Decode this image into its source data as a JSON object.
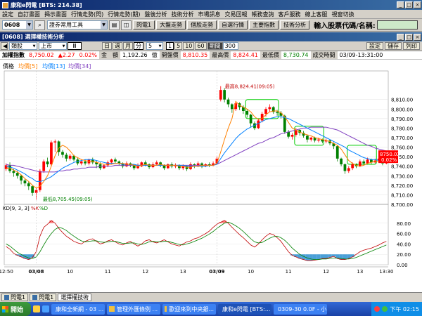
{
  "window": {
    "title": "康和e閃電 [BTS: 214.38]",
    "buttons": [
      "_",
      "□",
      "×"
    ]
  },
  "menu": [
    "設定",
    "自訂畫面",
    "揭示畫面",
    "行情走勢(閃)",
    "行情走勢(期)",
    "盤後分析",
    "技術分析",
    "市場訊息",
    "交易回報",
    "帳務查詢",
    "客戶服務",
    "線上客服",
    "視窗切換"
  ],
  "toolbar": {
    "stock_code": "0608",
    "tool_dropdown": "證券常用工具",
    "buttons": [
      "閃電1",
      "大盤走勢",
      "個股走勢",
      "自選行情",
      "主要指數",
      "技術分析"
    ],
    "prompt_label": "輸入股票代碼/名稱:",
    "prompt_value": ""
  },
  "chart_window": {
    "title": "[0608] 選擇權技術分析",
    "buttons": [
      "_",
      "□",
      "×"
    ],
    "controls": {
      "category": "類股",
      "market": "上市",
      "period_units": [
        "日",
        "週",
        "月",
        "分"
      ],
      "active_period_unit": "分",
      "interval_value": "5",
      "interval_options": [
        "1",
        "5",
        "10",
        "60"
      ],
      "active_interval": "1",
      "volume_label": "期間",
      "volume_value": "300",
      "right_buttons": [
        "設定",
        "儲存",
        "列印"
      ]
    },
    "quote": {
      "name_label": "加權指數",
      "price": "8,750.02",
      "change": "▲2.27",
      "change_pct": "0.02%",
      "amount_label": "金　額",
      "amount": "1,192.26",
      "amount_unit": "億",
      "open_label": "開盤價",
      "open": "8,810.35",
      "high_label": "最高價",
      "high": "8,824.41",
      "low_label": "最低價",
      "low": "8,730.74",
      "time_label": "成交時間",
      "time": "03/09-13:31:00"
    }
  },
  "chart_data": {
    "type": "candlestick",
    "price_panel": {
      "legend_title": "價格",
      "legend_items": [
        {
          "label": "均價[5]",
          "color": "#ff8000"
        },
        {
          "label": "均價[13]",
          "color": "#0080ff"
        },
        {
          "label": "均價[34]",
          "color": "#8040c0"
        }
      ],
      "ylim": [
        8700,
        8840
      ],
      "yticks": [
        "8,810.00",
        "8,800.00",
        "8,790.00",
        "8,780.00",
        "8,770.00",
        "8,760.00",
        "8,750.00",
        "8,740.00",
        "8,730.00",
        "8,720.00",
        "8,710.00",
        "8,700.00"
      ],
      "ytick_values": [
        8810,
        8800,
        8790,
        8780,
        8770,
        8760,
        8750,
        8740,
        8730,
        8720,
        8710,
        8700
      ],
      "annotations": [
        {
          "text": "最高8,824.41(09:05)"
        },
        {
          "text": "最低8,705.45(09:05)"
        }
      ],
      "last_price_box": {
        "value": "8750.02",
        "pct": "0.02%"
      },
      "highlight_boxes": 3
    },
    "kd_panel": {
      "legend": "KD[9, 3, 3]",
      "k_label": "%K",
      "d_label": "%D",
      "ylim": [
        0,
        100
      ],
      "yticks": [
        "80.00",
        "60.00",
        "40.00",
        "20.00",
        "0.00"
      ],
      "ytick_values": [
        80,
        60,
        40,
        20,
        0
      ]
    },
    "x_labels": [
      "12:50",
      "03/08",
      "10",
      "11",
      "12",
      "13",
      "03/09",
      "10",
      "11",
      "12",
      "13",
      "13:30"
    ],
    "x_label_positions": [
      0,
      8,
      17,
      27,
      37,
      47,
      56,
      65,
      75,
      85,
      94,
      101
    ],
    "candles": [
      [
        8737,
        8741,
        8743,
        8735
      ],
      [
        8741,
        8735,
        8744,
        8733
      ],
      [
        8735,
        8733,
        8737,
        8729
      ],
      [
        8733,
        8730,
        8735,
        8727
      ],
      [
        8730,
        8725,
        8731,
        8721
      ],
      [
        8725,
        8722,
        8727,
        8719
      ],
      [
        8722,
        8719,
        8724,
        8715
      ],
      [
        8719,
        8712,
        8720,
        8709
      ],
      [
        8712,
        8715,
        8717,
        8705
      ],
      [
        8715,
        8735,
        8737,
        8713
      ],
      [
        8735,
        8745,
        8747,
        8733
      ],
      [
        8745,
        8742,
        8749,
        8739
      ],
      [
        8742,
        8765,
        8767,
        8740
      ],
      [
        8765,
        8766,
        8768,
        8755
      ],
      [
        8766,
        8755,
        8767,
        8751
      ],
      [
        8755,
        8752,
        8757,
        8749
      ],
      [
        8752,
        8748,
        8754,
        8745
      ],
      [
        8748,
        8751,
        8753,
        8746
      ],
      [
        8751,
        8747,
        8752,
        8745
      ],
      [
        8747,
        8743,
        8749,
        8741
      ],
      [
        8743,
        8745,
        8747,
        8741
      ],
      [
        8745,
        8743,
        8747,
        8741
      ],
      [
        8743,
        8747,
        8748,
        8741
      ],
      [
        8747,
        8744,
        8749,
        8742
      ],
      [
        8744,
        8742,
        8746,
        8738
      ],
      [
        8742,
        8738,
        8744,
        8736
      ],
      [
        8738,
        8741,
        8742,
        8737
      ],
      [
        8741,
        8744,
        8746,
        8739
      ],
      [
        8744,
        8747,
        8748,
        8742
      ],
      [
        8747,
        8745,
        8749,
        8743
      ],
      [
        8745,
        8743,
        8746,
        8741
      ],
      [
        8743,
        8740,
        8744,
        8738
      ],
      [
        8740,
        8743,
        8745,
        8739
      ],
      [
        8743,
        8741,
        8744,
        8739
      ],
      [
        8741,
        8738,
        8742,
        8736
      ],
      [
        8738,
        8740,
        8743,
        8737
      ],
      [
        8740,
        8744,
        8745,
        8739
      ],
      [
        8744,
        8742,
        8746,
        8740
      ],
      [
        8742,
        8739,
        8743,
        8737
      ],
      [
        8739,
        8742,
        8744,
        8738
      ],
      [
        8742,
        8744,
        8746,
        8741
      ],
      [
        8744,
        8741,
        8745,
        8739
      ],
      [
        8741,
        8738,
        8742,
        8736
      ],
      [
        8738,
        8742,
        8743,
        8737
      ],
      [
        8742,
        8740,
        8744,
        8738
      ],
      [
        8740,
        8741,
        8743,
        8738
      ],
      [
        8741,
        8738,
        8742,
        8736
      ],
      [
        8738,
        8740,
        8742,
        8736
      ],
      [
        8740,
        8737,
        8741,
        8735
      ],
      [
        8737,
        8742,
        8744,
        8736
      ],
      [
        8742,
        8741,
        8743,
        8738
      ],
      [
        8741,
        8743,
        8745,
        8739
      ],
      [
        8743,
        8740,
        8744,
        8738
      ],
      [
        8740,
        8742,
        8743,
        8739
      ],
      [
        8742,
        8741,
        8744,
        8739
      ],
      [
        8741,
        8743,
        8745,
        8740
      ],
      [
        8743,
        8748,
        8750,
        8742
      ],
      [
        8810,
        8820,
        8824,
        8808
      ],
      [
        8820,
        8810,
        8822,
        8807
      ],
      [
        8810,
        8805,
        8812,
        8802
      ],
      [
        8805,
        8800,
        8806,
        8796
      ],
      [
        8800,
        8806,
        8808,
        8798
      ],
      [
        8806,
        8802,
        8807,
        8799
      ],
      [
        8802,
        8798,
        8804,
        8795
      ],
      [
        8798,
        8794,
        8800,
        8791
      ],
      [
        8794,
        8785,
        8795,
        8781
      ],
      [
        8785,
        8780,
        8787,
        8778
      ],
      [
        8780,
        8788,
        8790,
        8779
      ],
      [
        8788,
        8795,
        8797,
        8786
      ],
      [
        8795,
        8800,
        8802,
        8792
      ],
      [
        8800,
        8802,
        8805,
        8797
      ],
      [
        8802,
        8797,
        8803,
        8795
      ],
      [
        8797,
        8796,
        8799,
        8793
      ],
      [
        8796,
        8793,
        8798,
        8790
      ],
      [
        8793,
        8776,
        8794,
        8774
      ],
      [
        8776,
        8771,
        8778,
        8769
      ],
      [
        8771,
        8773,
        8775,
        8768
      ],
      [
        8773,
        8778,
        8780,
        8771
      ],
      [
        8778,
        8775,
        8779,
        8772
      ],
      [
        8775,
        8772,
        8777,
        8770
      ],
      [
        8772,
        8768,
        8773,
        8765
      ],
      [
        8768,
        8770,
        8771,
        8766
      ],
      [
        8770,
        8767,
        8771,
        8765
      ],
      [
        8767,
        8768,
        8770,
        8765
      ],
      [
        8768,
        8766,
        8769,
        8764
      ],
      [
        8766,
        8767,
        8769,
        8764
      ],
      [
        8767,
        8764,
        8768,
        8762
      ],
      [
        8764,
        8761,
        8765,
        8758
      ],
      [
        8761,
        8748,
        8762,
        8745
      ],
      [
        8748,
        8742,
        8749,
        8740
      ],
      [
        8742,
        8735,
        8743,
        8732
      ],
      [
        8735,
        8738,
        8740,
        8733
      ],
      [
        8738,
        8742,
        8744,
        8736
      ],
      [
        8742,
        8740,
        8743,
        8738
      ],
      [
        8740,
        8745,
        8747,
        8739
      ],
      [
        8745,
        8743,
        8747,
        8741
      ],
      [
        8743,
        8747,
        8749,
        8742
      ],
      [
        8747,
        8744,
        8748,
        8742
      ],
      [
        8744,
        8746,
        8748,
        8743
      ],
      [
        8746,
        8748,
        8749,
        8744
      ],
      [
        8748,
        8743,
        8749,
        8741
      ],
      [
        8743,
        8750,
        8752,
        8742
      ]
    ],
    "ma5": [
      8738,
      8738,
      8736,
      8734,
      8731,
      8727,
      8724,
      8720,
      8717,
      8719,
      8724,
      8730,
      8740,
      8751,
      8759,
      8762,
      8760,
      8756,
      8751,
      8749,
      8747,
      8746,
      8745,
      8745,
      8744,
      8743,
      8742,
      8742,
      8742,
      8743,
      8743,
      8743,
      8742,
      8742,
      8741,
      8740,
      8741,
      8742,
      8741,
      8741,
      8741,
      8742,
      8741,
      8741,
      8741,
      8741,
      8740,
      8740,
      8739,
      8739,
      8740,
      8740,
      8741,
      8741,
      8741,
      8741,
      8743,
      8755,
      8768,
      8780,
      8790,
      8808,
      8804,
      8802,
      8800,
      8797,
      8792,
      8789,
      8790,
      8794,
      8797,
      8798,
      8798,
      8796,
      8792,
      8786,
      8780,
      8778,
      8776,
      8774,
      8773,
      8772,
      8770,
      8769,
      8768,
      8767,
      8766,
      8764,
      8762,
      8758,
      8752,
      8746,
      8743,
      8741,
      8740,
      8741,
      8743,
      8744,
      8745,
      8745,
      8745,
      8746
    ],
    "ma13": [
      8740,
      8739,
      8738,
      8736,
      8734,
      8732,
      8729,
      8727,
      8724,
      8724,
      8725,
      8727,
      8729,
      8732,
      8735,
      8738,
      8740,
      8742,
      8744,
      8745,
      8746,
      8747,
      8747,
      8747,
      8746,
      8745,
      8744,
      8743,
      8743,
      8743,
      8743,
      8742,
      8742,
      8742,
      8742,
      8741,
      8741,
      8741,
      8741,
      8741,
      8741,
      8741,
      8741,
      8741,
      8741,
      8741,
      8741,
      8741,
      8740,
      8740,
      8740,
      8740,
      8740,
      8740,
      8741,
      8741,
      8742,
      8748,
      8754,
      8759,
      8764,
      8769,
      8773,
      8776,
      8779,
      8781,
      8783,
      8785,
      8787,
      8789,
      8790,
      8791,
      8792,
      8792,
      8791,
      8790,
      8788,
      8786,
      8784,
      8782,
      8780,
      8778,
      8776,
      8774,
      8772,
      8770,
      8768,
      8766,
      8764,
      8762,
      8760,
      8757,
      8755,
      8753,
      8751,
      8749,
      8748,
      8747,
      8747,
      8746,
      8746,
      8746
    ],
    "ma34": [
      8742,
      8741,
      8741,
      8740,
      8739,
      8738,
      8737,
      8736,
      8735,
      8734,
      8734,
      8734,
      8734,
      8734,
      8735,
      8735,
      8736,
      8736,
      8737,
      8737,
      8738,
      8738,
      8739,
      8739,
      8739,
      8740,
      8740,
      8740,
      8740,
      8741,
      8741,
      8741,
      8741,
      8741,
      8741,
      8741,
      8741,
      8741,
      8741,
      8741,
      8741,
      8741,
      8741,
      8741,
      8741,
      8741,
      8741,
      8741,
      8741,
      8741,
      8741,
      8741,
      8741,
      8741,
      8741,
      8741,
      8742,
      8744,
      8746,
      8748,
      8750,
      8752,
      8754,
      8756,
      8758,
      8760,
      8762,
      8764,
      8765,
      8767,
      8769,
      8770,
      8772,
      8774,
      8775,
      8776,
      8777,
      8778,
      8779,
      8780,
      8780,
      8781,
      8781,
      8781,
      8781,
      8781,
      8780,
      8779,
      8778,
      8776,
      8774,
      8772,
      8770,
      8768,
      8766,
      8764,
      8762,
      8761,
      8759,
      8758,
      8757,
      8756
    ],
    "k": [
      35,
      30,
      22,
      18,
      15,
      12,
      10,
      14,
      25,
      55,
      72,
      78,
      85,
      80,
      70,
      62,
      55,
      50,
      45,
      42,
      40,
      45,
      48,
      50,
      45,
      40,
      42,
      46,
      48,
      44,
      40,
      38,
      42,
      45,
      40,
      36,
      40,
      46,
      48,
      44,
      42,
      45,
      48,
      44,
      40,
      38,
      36,
      40,
      44,
      46,
      50,
      52,
      56,
      60,
      65,
      72,
      78,
      82,
      85,
      80,
      72,
      65,
      58,
      52,
      45,
      38,
      34,
      40,
      48,
      55,
      60,
      58,
      52,
      45,
      35,
      25,
      18,
      15,
      12,
      10,
      8,
      8,
      9,
      10,
      12,
      12,
      14,
      16,
      12,
      10,
      10,
      12,
      15,
      20,
      25,
      28,
      30,
      32,
      35,
      38,
      42,
      45
    ],
    "d": [
      40,
      36,
      30,
      24,
      20,
      16,
      13,
      12,
      15,
      25,
      38,
      50,
      60,
      68,
      72,
      70,
      66,
      60,
      55,
      50,
      46,
      44,
      45,
      46,
      46,
      44,
      43,
      44,
      45,
      45,
      43,
      41,
      41,
      42,
      42,
      40,
      39,
      41,
      44,
      45,
      44,
      44,
      45,
      45,
      43,
      41,
      39,
      38,
      40,
      42,
      45,
      48,
      51,
      55,
      59,
      64,
      70,
      75,
      80,
      82,
      79,
      75,
      70,
      64,
      57,
      50,
      44,
      42,
      43,
      47,
      51,
      54,
      55,
      52,
      47,
      40,
      32,
      26,
      20,
      16,
      13,
      11,
      10,
      10,
      11,
      11,
      12,
      13,
      13,
      12,
      11,
      11,
      12,
      14,
      17,
      20,
      23,
      26,
      29,
      32,
      35,
      38
    ]
  },
  "bottom_tabs": [
    "閃電1",
    "閃電1",
    "選擇權技術"
  ],
  "taskbar": {
    "start_label": "開始",
    "tasks": [
      "康和全新網 - 03 ...",
      "管理外匯條例 ...",
      "歡迎來到中央銀...",
      "康和e閃電 [BTS:...",
      "0309-30 0.0F - 小..."
    ],
    "active_task": 3,
    "clock": "下午 02:15"
  },
  "colors": {
    "up": "#ff0000",
    "down": "#008000",
    "ma5": "#ff8000",
    "ma13": "#0080ff",
    "ma34": "#8040c0",
    "highlight": "#00cc00",
    "k_line": "#c00000",
    "d_line": "#008000"
  }
}
